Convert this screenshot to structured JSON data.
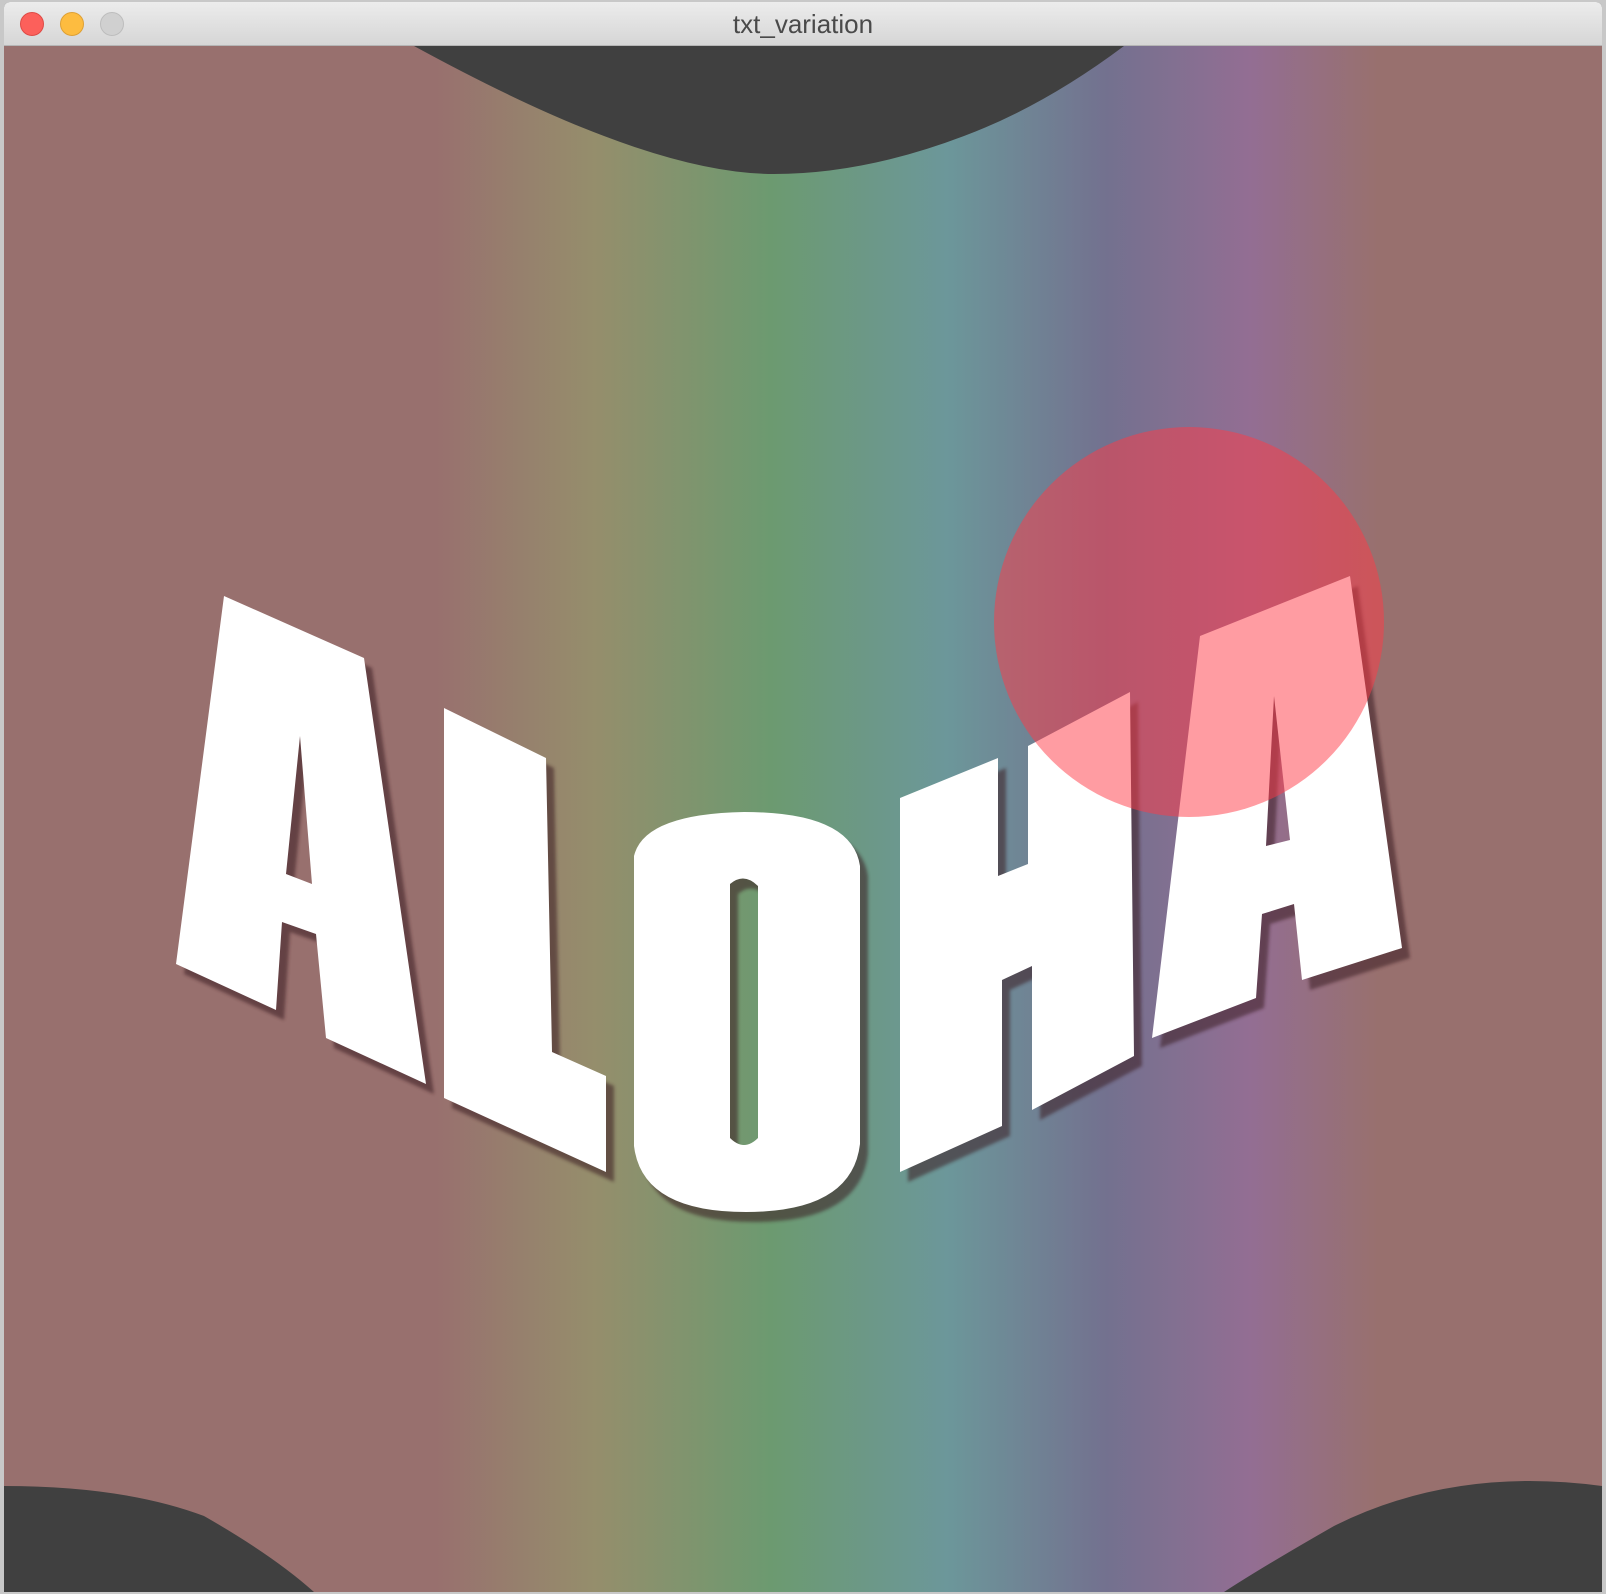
{
  "window": {
    "title": "txt_variation",
    "buttons": {
      "close": "close",
      "minimize": "minimize",
      "zoom": "zoom"
    }
  },
  "canvas": {
    "text": "ALOHA",
    "background_color": "#404040",
    "gradient_colors": [
      "#98706e",
      "#98706e",
      "#958e6c",
      "#6c9a70",
      "#6c979a",
      "#73718f",
      "#936e93",
      "#98706e",
      "#98706e"
    ],
    "text_color": "#ffffff",
    "circle_color": "#ff3a46",
    "circle_opacity": 0.5
  }
}
